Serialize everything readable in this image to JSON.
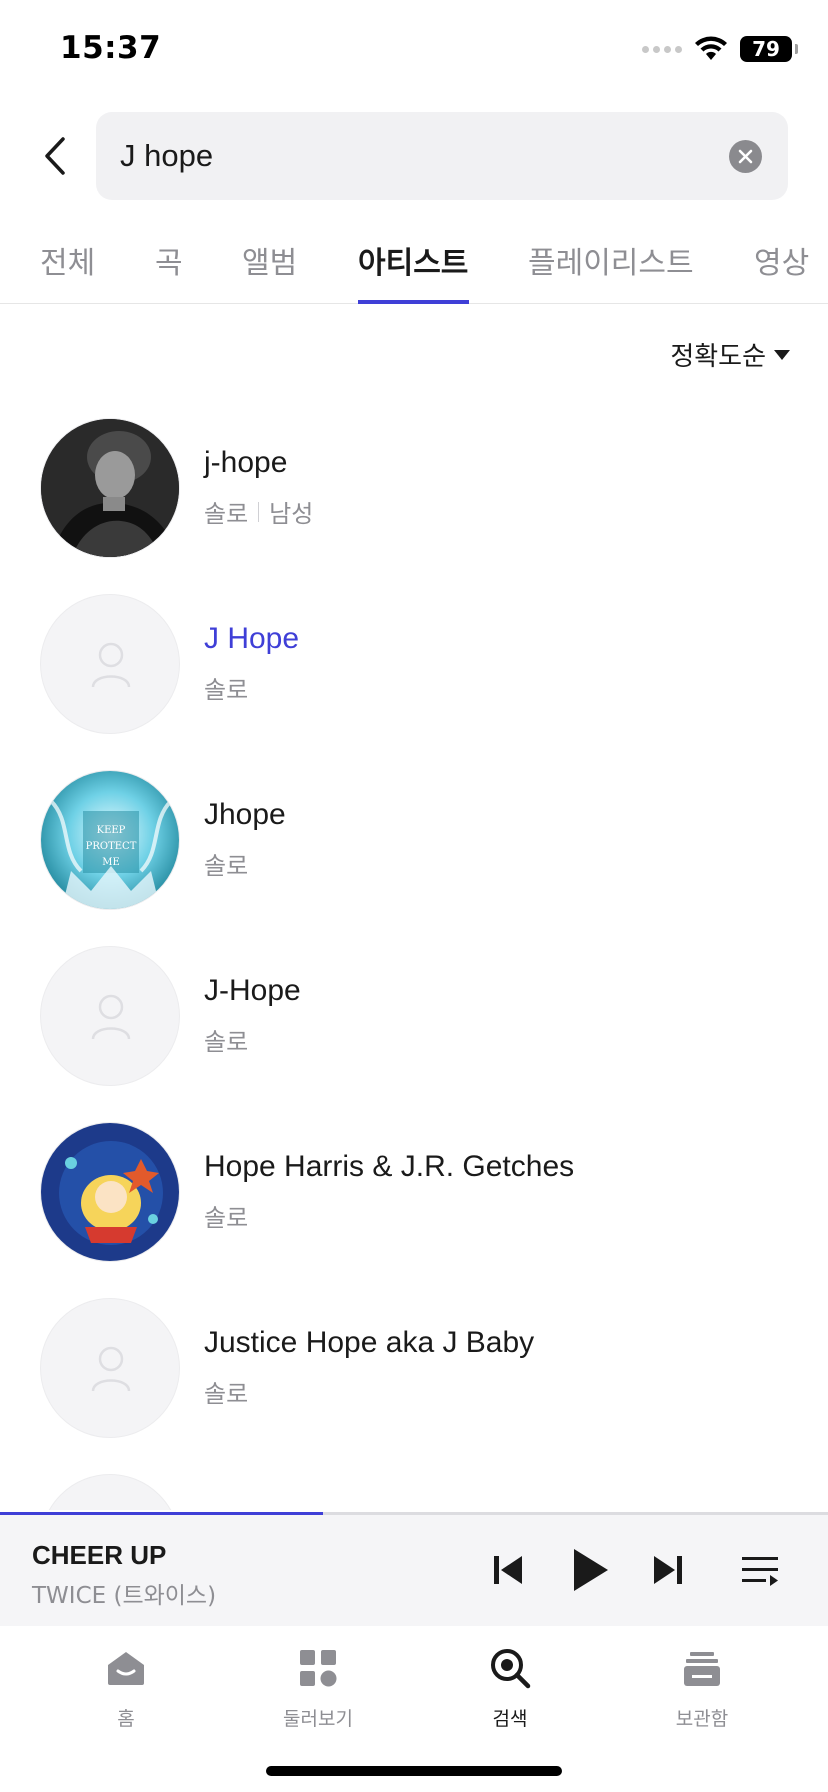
{
  "status_bar": {
    "time": "15:37",
    "battery": "79"
  },
  "search": {
    "value": "J hope",
    "placeholder": ""
  },
  "tabs": [
    {
      "label": "전체"
    },
    {
      "label": "곡"
    },
    {
      "label": "앨범"
    },
    {
      "label": "아티스트"
    },
    {
      "label": "플레이리스트"
    },
    {
      "label": "영상"
    }
  ],
  "active_tab": "아티스트",
  "sort": {
    "label": "정확도순"
  },
  "artists": [
    {
      "name": "j-hope",
      "type": "솔로",
      "gender": "남성",
      "avatar": "photo"
    },
    {
      "name": "J Hope",
      "type": "솔로",
      "avatar": "placeholder-person-icon"
    },
    {
      "name": "Jhope",
      "type": "솔로",
      "avatar": "album-art"
    },
    {
      "name": "J-Hope",
      "type": "솔로",
      "avatar": "placeholder-person-icon"
    },
    {
      "name": "Hope Harris & J.R. Getches",
      "type": "솔로",
      "avatar": "album-art"
    },
    {
      "name": "Justice Hope aka J Baby",
      "type": "솔로",
      "avatar": "placeholder-person-icon"
    }
  ],
  "now_playing": {
    "title": "CHEER UP",
    "artist": "TWICE (트와이스)",
    "progress": 0.39
  },
  "bottom_nav": [
    {
      "label": "홈",
      "icon": "home-icon"
    },
    {
      "label": "둘러보기",
      "icon": "browse-grid-icon"
    },
    {
      "label": "검색",
      "icon": "search-icon"
    },
    {
      "label": "보관함",
      "icon": "library-icon"
    }
  ],
  "colors": {
    "accent": "#3f3fd7",
    "muted": "#8e8e93",
    "player_bg": "#f5f5f7"
  }
}
